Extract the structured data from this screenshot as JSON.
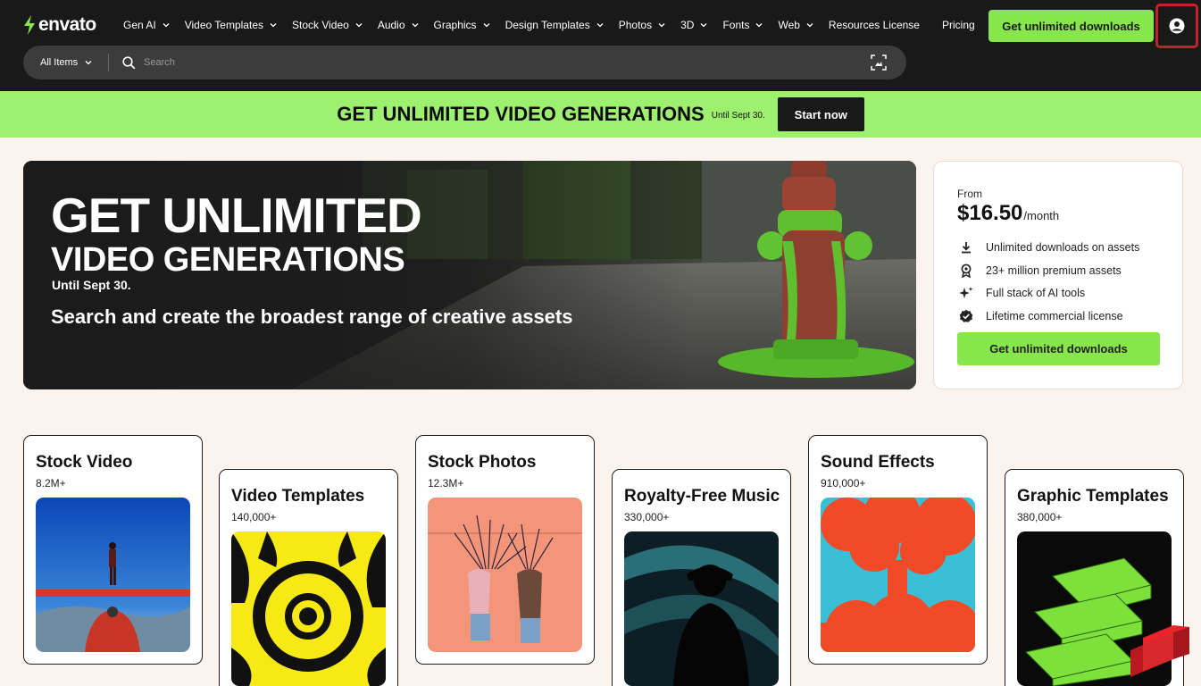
{
  "header": {
    "logo_text": "envato",
    "nav": [
      {
        "label": "Gen AI",
        "dropdown": true
      },
      {
        "label": "Video Templates",
        "dropdown": true
      },
      {
        "label": "Stock Video",
        "dropdown": true
      },
      {
        "label": "Audio",
        "dropdown": true
      },
      {
        "label": "Graphics",
        "dropdown": true
      },
      {
        "label": "Design Templates",
        "dropdown": true
      },
      {
        "label": "Photos",
        "dropdown": true
      },
      {
        "label": "3D",
        "dropdown": true
      },
      {
        "label": "Fonts",
        "dropdown": true
      },
      {
        "label": "Web",
        "dropdown": true
      },
      {
        "label": "Resources License",
        "dropdown": false
      },
      {
        "label": "Pricing",
        "dropdown": false
      }
    ],
    "cta_label": "Get unlimited downloads",
    "user_icon": "user-account-icon"
  },
  "search": {
    "category_label": "All Items",
    "placeholder": "Search",
    "image_search_icon": "image-search-icon"
  },
  "promo": {
    "title": "GET UNLIMITED VIDEO GENERATIONS",
    "subtitle": "Until Sept 30.",
    "button_label": "Start now"
  },
  "hero": {
    "headline_1": "GET UNLIMITED",
    "headline_2": "VIDEO GENERATIONS",
    "until": "Until Sept 30.",
    "tagline": "Search and create the broadest range of creative assets"
  },
  "pricing": {
    "from_label": "From",
    "price": "$16.50",
    "period": "/month",
    "features": [
      {
        "icon": "download-icon",
        "label": "Unlimited downloads on assets"
      },
      {
        "icon": "award-icon",
        "label": "23+ million premium assets"
      },
      {
        "icon": "sparkle-icon",
        "label": "Full stack of AI tools"
      },
      {
        "icon": "check-badge-icon",
        "label": "Lifetime commercial license"
      }
    ],
    "button_label": "Get unlimited downloads"
  },
  "categories": [
    {
      "title": "Stock Video",
      "count": "8.2M+"
    },
    {
      "title": "Video Templates",
      "count": "140,000+"
    },
    {
      "title": "Stock Photos",
      "count": "12.3M+"
    },
    {
      "title": "Royalty-Free Music",
      "count": "330,000+"
    },
    {
      "title": "Sound Effects",
      "count": "910,000+"
    },
    {
      "title": "Graphic Templates",
      "count": "380,000+"
    }
  ],
  "colors": {
    "header_bg": "#191919",
    "accent_green": "#87e64b",
    "promo_green": "#9ef06f",
    "page_bg": "#fbf3ee",
    "highlight_red": "#c0242b"
  }
}
